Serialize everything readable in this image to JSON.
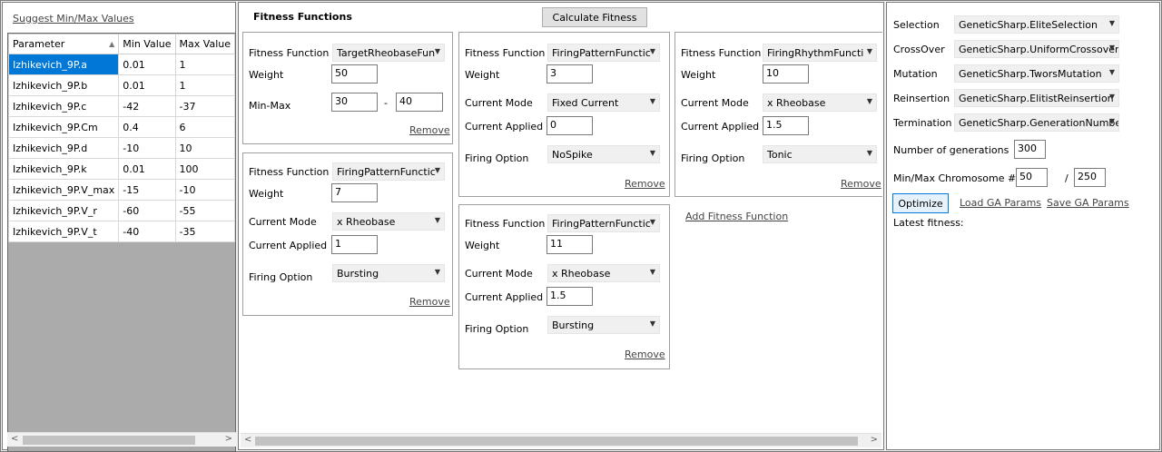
{
  "left": {
    "suggest_link": "Suggest Min/Max Values",
    "columns": [
      "Parameter",
      "Min Value",
      "Max Value"
    ],
    "rows": [
      [
        "Izhikevich_9P.a",
        "0.01",
        "1"
      ],
      [
        "Izhikevich_9P.b",
        "0.01",
        "1"
      ],
      [
        "Izhikevich_9P.c",
        "-42",
        "-37"
      ],
      [
        "Izhikevich_9P.Cm",
        "0.4",
        "6"
      ],
      [
        "Izhikevich_9P.d",
        "-10",
        "10"
      ],
      [
        "Izhikevich_9P.k",
        "0.01",
        "100"
      ],
      [
        "Izhikevich_9P.V_max",
        "-15",
        "-10"
      ],
      [
        "Izhikevich_9P.V_r",
        "-60",
        "-55"
      ],
      [
        "Izhikevich_9P.V_t",
        "-40",
        "-35"
      ]
    ]
  },
  "center": {
    "title": "Fitness Functions",
    "calculate_button": "Calculate Fitness",
    "add_link": "Add Fitness Function",
    "remove_label": "Remove",
    "labels": {
      "fitness_function": "Fitness Function",
      "weight": "Weight",
      "min_max": "Min-Max",
      "dash": "-",
      "current_mode": "Current Mode",
      "current_applied": "Current Applied",
      "firing_option": "Firing Option"
    },
    "ff1": {
      "function": "TargetRheobaseFun",
      "weight": "50",
      "min": "30",
      "max": "40"
    },
    "ff2": {
      "function": "FiringPatternFunctic",
      "weight": "7",
      "current_mode": "x Rheobase",
      "current_applied": "1",
      "firing_option": "Bursting"
    },
    "ff3": {
      "function": "FiringPatternFunctic",
      "weight": "3",
      "current_mode": "Fixed Current",
      "current_applied": "0",
      "firing_option": "NoSpike"
    },
    "ff4": {
      "function": "FiringPatternFunctic",
      "weight": "11",
      "current_mode": "x Rheobase",
      "current_applied": "1.5",
      "firing_option": "Bursting"
    },
    "ff5": {
      "function": "FiringRhythmFuncti",
      "weight": "10",
      "current_mode": "x Rheobase",
      "current_applied": "1.5",
      "firing_option": "Tonic"
    }
  },
  "right": {
    "selection_label": "Selection",
    "selection_value": "GeneticSharp.EliteSelection",
    "crossover_label": "CrossOver",
    "crossover_value": "GeneticSharp.UniformCrossover",
    "mutation_label": "Mutation",
    "mutation_value": "GeneticSharp.TworsMutation",
    "reinsertion_label": "Reinsertion",
    "reinsertion_value": "GeneticSharp.ElitistReinsertion",
    "termination_label": "Termination",
    "termination_value": "GeneticSharp.GenerationNumbe",
    "generations_label": "Number of generations",
    "generations_value": "300",
    "chromosome_label": "Min/Max Chromosome #",
    "chromosome_min": "50",
    "chromosome_sep": "/",
    "chromosome_max": "250",
    "optimize_button": "Optimize",
    "load_link": "Load GA Params",
    "save_link": "Save GA Params",
    "latest_fitness": "Latest fitness:"
  },
  "colors": {
    "selection": "#0078d7",
    "grid_background": "#ababab",
    "panel": "#ffffff",
    "window": "#f0f0f0"
  }
}
